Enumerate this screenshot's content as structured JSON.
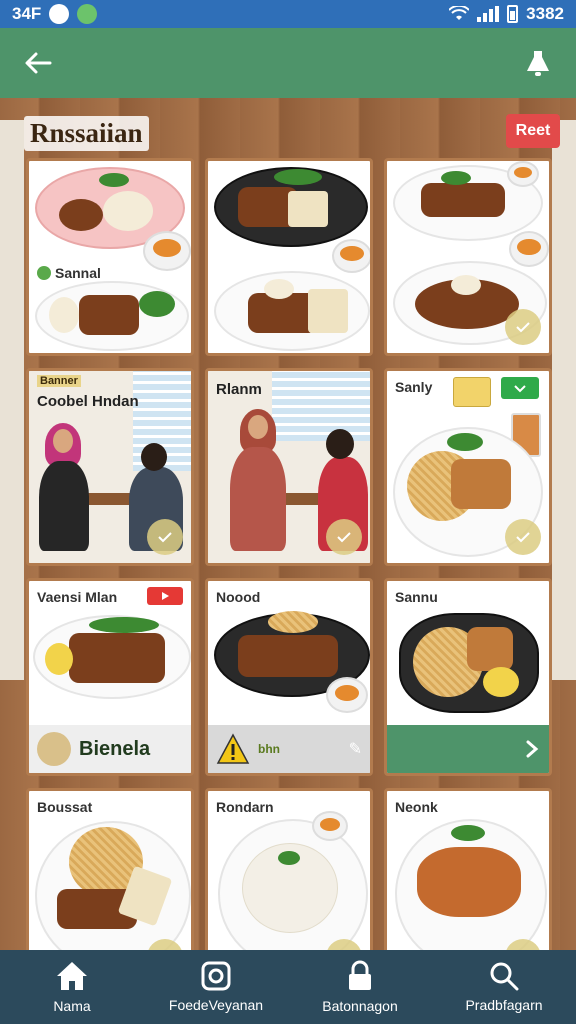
{
  "status_bar": {
    "time_left": "34F",
    "time_right": "3382"
  },
  "header": {
    "back_icon": "back-arrow-icon",
    "right_icon": "bell-icon",
    "colors": {
      "app_bar": "#4e946a",
      "status_bar": "#2f6fb8"
    }
  },
  "page": {
    "title": "Rnssaiian",
    "action_label": "Reet"
  },
  "cards": [
    {
      "label": "Sannal"
    },
    {
      "label": ""
    },
    {
      "label": ""
    },
    {
      "tag": "Banner",
      "label": "Coobel Hndan"
    },
    {
      "label": "Rlanm"
    },
    {
      "label": "Sanly"
    },
    {
      "label": "Vaensi Mlan",
      "strip": "Bienela"
    },
    {
      "label": "Noood",
      "strip": "bhn"
    },
    {
      "label": "Sannu"
    },
    {
      "label": "Boussat"
    },
    {
      "label": "Rondarn"
    },
    {
      "label": "Neonk"
    }
  ],
  "nav": {
    "items": [
      {
        "label": "Nama",
        "icon": "home-icon"
      },
      {
        "label": "FoedeVeyanan",
        "icon": "instagram-icon"
      },
      {
        "label": "Batonnagon",
        "icon": "lock-icon"
      },
      {
        "label": "Pradbfagarn",
        "icon": "search-icon"
      }
    ]
  }
}
